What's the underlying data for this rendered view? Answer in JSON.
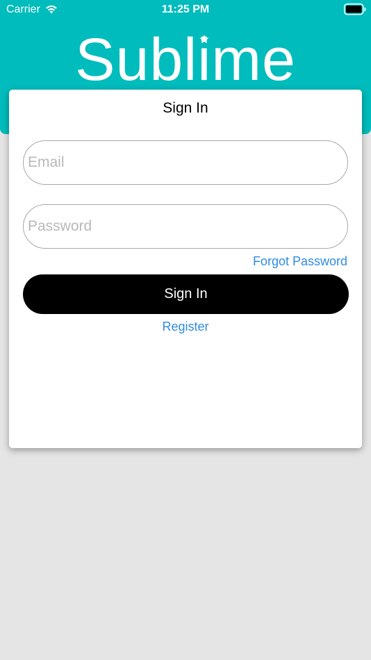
{
  "status_bar": {
    "carrier": "Carrier",
    "time": "11:25 PM"
  },
  "header": {
    "logo_text": "Sublime",
    "background_color": "#00bcbc"
  },
  "card": {
    "title": "Sign In",
    "email_placeholder": "Email",
    "password_placeholder": "Password",
    "forgot_label": "Forgot Password",
    "signin_label": "Sign In",
    "register_label": "Register"
  },
  "colors": {
    "link": "#2f8ce0",
    "primary_button": "#000000",
    "page_background": "#e5e5e5"
  }
}
